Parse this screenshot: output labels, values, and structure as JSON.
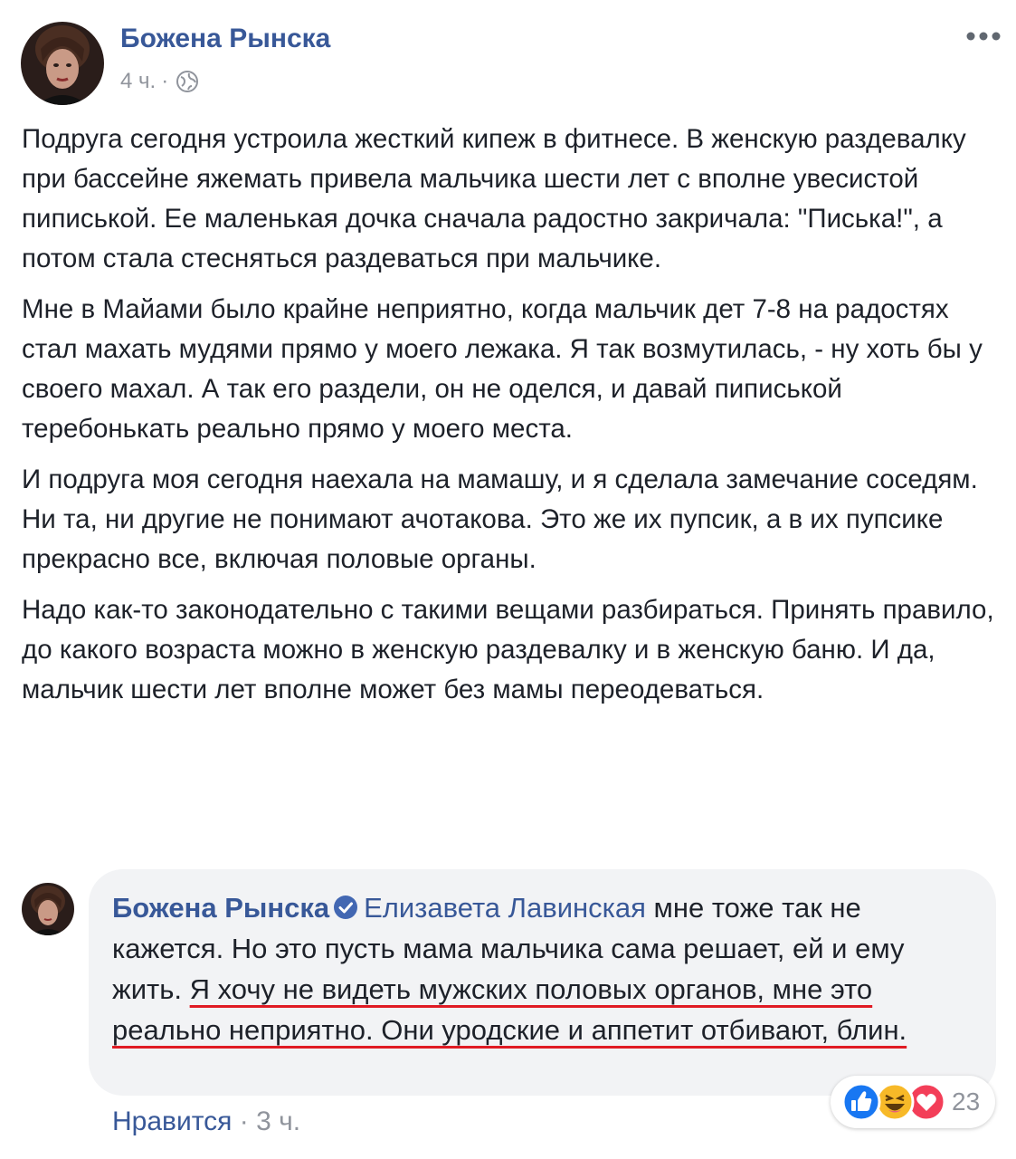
{
  "post": {
    "author": "Божена Рынска",
    "time": "4 ч.",
    "meta_separator": "·",
    "paragraphs": [
      "Подруга сегодня устроила жесткий кипеж в фитнесе. В женскую раздевалку при бассейне яжемать привела мальчика шести лет с вполне увесистой пиписькой. Ее маленькая дочка сначала радостно закричала: \"Писька!\", а потом стала стесняться раздеваться при мальчике.",
      "Мне в Майами было крайне неприятно, когда мальчик дет 7-8 на радостях стал махать мудями прямо у моего лежака. Я так возмутилась, - ну хоть бы у своего махал. А так его раздели, он не оделся, и давай пиписькой теребонькать реально прямо у моего места.",
      "И подруга моя сегодня наехала на мамашу, и я сделала замечание соседям. Ни та, ни другие не понимают ачотакова. Это же их пупсик, а в их пупсике прекрасно все, включая половые органы.",
      "Надо как-то законодательно с такими вещами разбираться. Принять правило, до какого возраста можно в женскую раздевалку и в женскую баню. И да, мальчик шести лет вполне может без мамы переодеваться."
    ]
  },
  "comment": {
    "author": "Божена Рынска",
    "mention": "Елизавета Лавинская",
    "text_plain": " мне тоже так не кажется. Но это пусть мама мальчика сама решает, ей и ему жить. ",
    "text_highlighted": "Я хочу не видеть мужских половых органов, мне это реально неприятно. Они уродские и аппетит отбивают, блин.",
    "like_label": "Нравится",
    "separator": " · ",
    "time": "3 ч.",
    "reactions": {
      "types": [
        "like-icon",
        "haha-icon",
        "love-icon"
      ],
      "count": "23"
    }
  },
  "colors": {
    "link_blue": "#385898",
    "meta_gray": "#90949c",
    "bubble_bg": "#f2f3f5",
    "highlight_underline": "#e01b24",
    "like_blue": "#1877f2",
    "haha_yellow": "#f7b928",
    "love_red": "#f33e58"
  }
}
